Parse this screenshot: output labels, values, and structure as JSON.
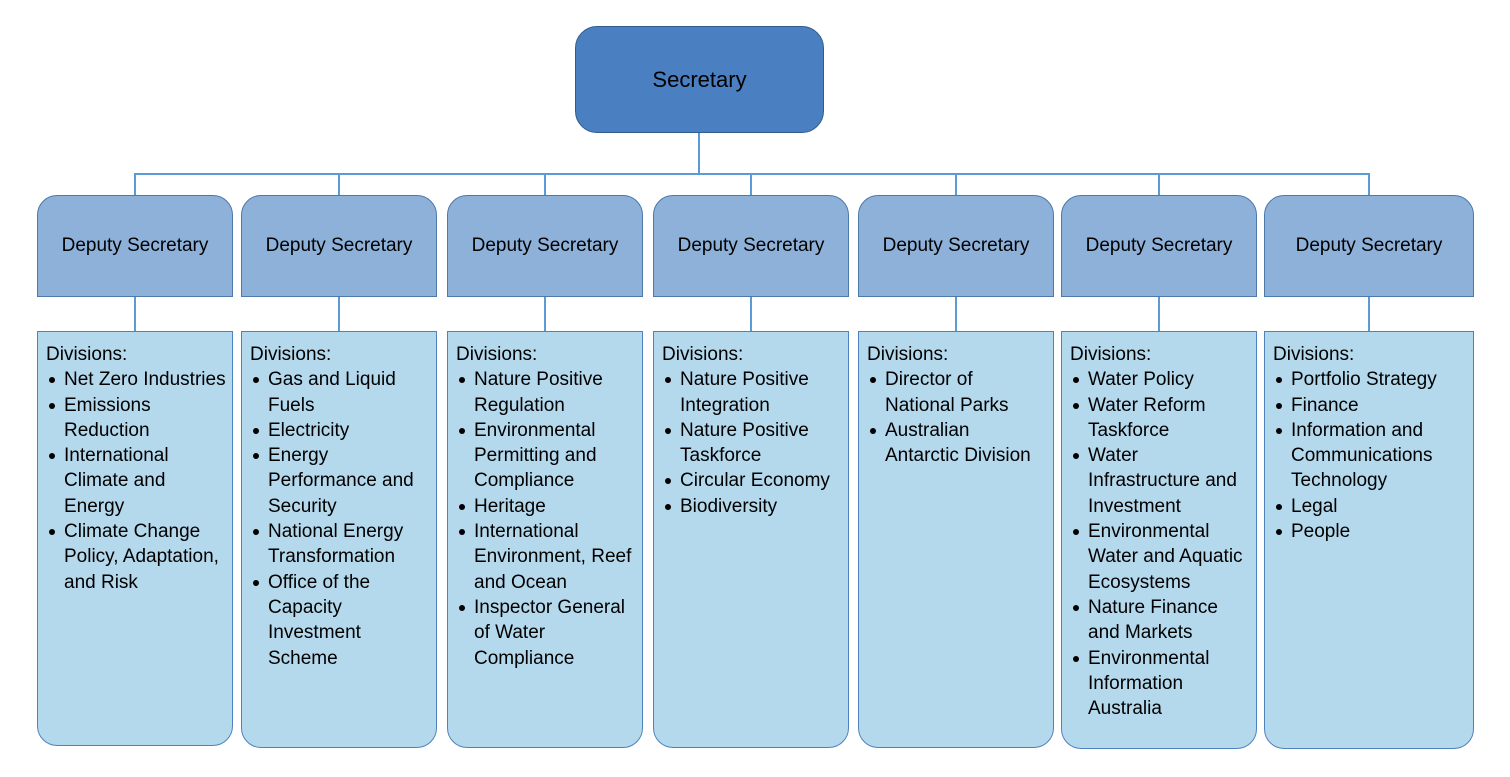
{
  "secretary": {
    "label": "Secretary"
  },
  "colors": {
    "secretary_fill": "#4A7FC1",
    "deputy_fill": "#8EB1D9",
    "division_fill": "#B4D8EC",
    "connector": "#5B9BD5"
  },
  "columns": [
    {
      "deputy": "Deputy Secretary",
      "divisions_label": "Divisions:",
      "divisions": [
        "Net Zero Industries",
        "Emissions Reduction",
        "International Climate and Energy",
        "Climate Change Policy, Adaptation, and Risk"
      ]
    },
    {
      "deputy": "Deputy Secretary",
      "divisions_label": "Divisions:",
      "divisions": [
        "Gas and Liquid Fuels",
        "Electricity",
        "Energy Performance and Security",
        "National Energy Transformation",
        "Office of the Capacity Investment Scheme"
      ]
    },
    {
      "deputy": "Deputy Secretary",
      "divisions_label": "Divisions:",
      "divisions": [
        "Nature Positive Regulation",
        "Environmental Permitting and Compliance",
        "Heritage",
        "International Environment, Reef and Ocean",
        "Inspector General of Water Compliance"
      ]
    },
    {
      "deputy": "Deputy Secretary",
      "divisions_label": "Divisions:",
      "divisions": [
        "Nature Positive Integration",
        "Nature Positive Taskforce",
        "Circular Economy",
        "Biodiversity"
      ]
    },
    {
      "deputy": "Deputy Secretary",
      "divisions_label": "Divisions:",
      "divisions": [
        "Director of National Parks",
        "Australian Antarctic Division"
      ]
    },
    {
      "deputy": "Deputy Secretary",
      "divisions_label": "Divisions:",
      "divisions": [
        "Water Policy",
        "Water Reform Taskforce",
        "Water Infrastructure and Investment",
        "Environmental Water and Aquatic Ecosystems",
        "Nature Finance and Markets",
        "Environmental Information Australia"
      ]
    },
    {
      "deputy": "Deputy Secretary",
      "divisions_label": "Divisions:",
      "divisions": [
        "Portfolio Strategy",
        "Finance",
        "Information and Communications Technology",
        "Legal",
        "People"
      ]
    }
  ]
}
